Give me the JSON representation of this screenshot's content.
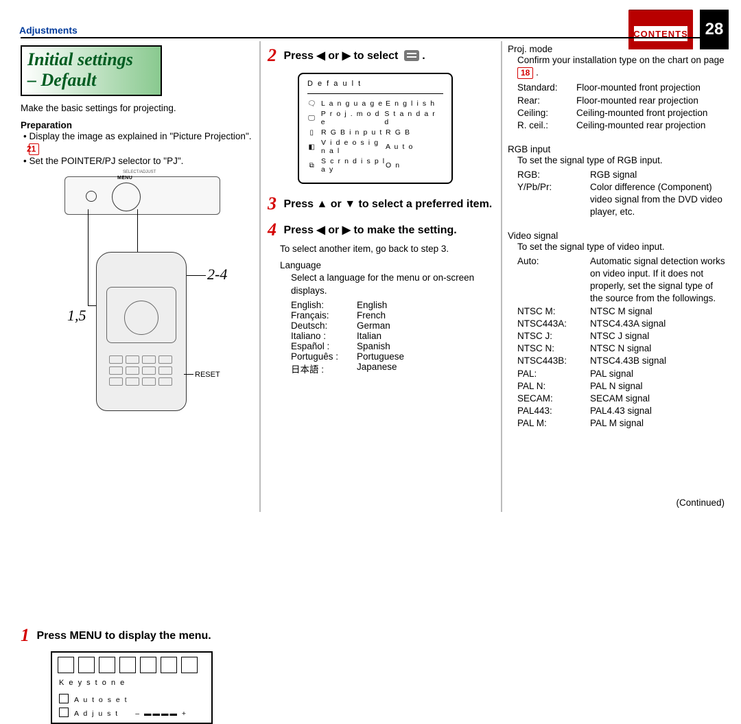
{
  "header": {
    "section": "Adjustments",
    "contents_label": "CONTENTS",
    "page_number": "28"
  },
  "title_line1": "Initial settings",
  "title_line2": "– Default",
  "intro": "Make the basic settings for projecting.",
  "preparation_heading": "Preparation",
  "prep_bullet1_a": "Display the image as explained in \"Picture Projection\". ",
  "prep_ref1": "21",
  "prep_bullet2": "Set the POINTER/PJ selector to \"PJ\".",
  "remote": {
    "label_24": "2-4",
    "label_15": "1,5",
    "reset": "RESET",
    "menu_small": "MENU",
    "select_adjust": "SELECT/ADJUST"
  },
  "step1": {
    "num": "1",
    "text": "Press MENU to display the menu.",
    "osd_title": "K e y s t o n e",
    "row_a": "A u t o  s e t",
    "row_b": "A d j u s t"
  },
  "step2": {
    "num": "2",
    "text_a": "Press ◀ or ▶ to select ",
    "text_b": " .",
    "osd_title": "D e f a u l t",
    "rows": [
      {
        "k": "L a n g u a g e",
        "v": "E n g l i s h"
      },
      {
        "k": "P r o j . m o d e",
        "v": "S t a n d a r d"
      },
      {
        "k": "R G B  i n p u t",
        "v": "R G B"
      },
      {
        "k": "V i d e o  s i g n a l",
        "v": "A u t o"
      },
      {
        "k": "S c r n  d i s p l a y",
        "v": "O n"
      }
    ]
  },
  "step3": {
    "num": "3",
    "text": "Press ▲ or ▼ to select a preferred item."
  },
  "step4": {
    "num": "4",
    "text": "Press ◀ or ▶ to make the setting.",
    "note": "To select another item, go back to step 3.",
    "lang_heading": "Language",
    "lang_desc": "Select a language for the menu or on-screen displays.",
    "languages": [
      {
        "k": "English:",
        "v": "English"
      },
      {
        "k": "Français:",
        "v": "French"
      },
      {
        "k": "Deutsch:",
        "v": "German"
      },
      {
        "k": "Italiano :",
        "v": "Italian"
      },
      {
        "k": "Español :",
        "v": "Spanish"
      },
      {
        "k": "Português :",
        "v": "Portuguese"
      },
      {
        "k": "日本語 :",
        "v": "Japanese"
      }
    ]
  },
  "col3": {
    "proj_heading": "Proj.  mode",
    "proj_desc_a": "Confirm your installation type on the chart on page ",
    "proj_ref": "18",
    "proj_desc_b": " .",
    "proj_modes": [
      {
        "k": "Standard:",
        "v": "Floor-mounted front projection"
      },
      {
        "k": "Rear:",
        "v": "Floor-mounted rear projection"
      },
      {
        "k": "Ceiling:",
        "v": "Ceiling-mounted front projection"
      },
      {
        "k": "R. ceil.:",
        "v": "Ceiling-mounted rear projection"
      }
    ],
    "rgb_heading": "RGB input",
    "rgb_desc": "To set the signal type of RGB input.",
    "rgb_rows": [
      {
        "k": "RGB:",
        "v": "RGB signal"
      },
      {
        "k": "Y/Pb/Pr:",
        "v": "Color difference (Component) video signal from the DVD video player, etc."
      }
    ],
    "video_heading": "Video signal",
    "video_desc": "To set the signal type of video input.",
    "video_rows": [
      {
        "k": "Auto:",
        "v": "Automatic signal detection works on video input. If it does not properly, set the signal type of the source from the followings."
      },
      {
        "k": "NTSC M:",
        "v": "NTSC M signal"
      },
      {
        "k": "NTSC443A:",
        "v": "NTSC4.43A signal"
      },
      {
        "k": "NTSC J:",
        "v": "NTSC J signal"
      },
      {
        "k": "NTSC N:",
        "v": "NTSC N signal"
      },
      {
        "k": "NTSC443B:",
        "v": "NTSC4.43B signal"
      },
      {
        "k": "PAL:",
        "v": "PAL signal"
      },
      {
        "k": "PAL N:",
        "v": "PAL N signal"
      },
      {
        "k": "SECAM:",
        "v": "SECAM signal"
      },
      {
        "k": "PAL443:",
        "v": "PAL4.43 signal"
      },
      {
        "k": "PAL M:",
        "v": "PAL M signal"
      }
    ],
    "continued": "(Continued)"
  }
}
